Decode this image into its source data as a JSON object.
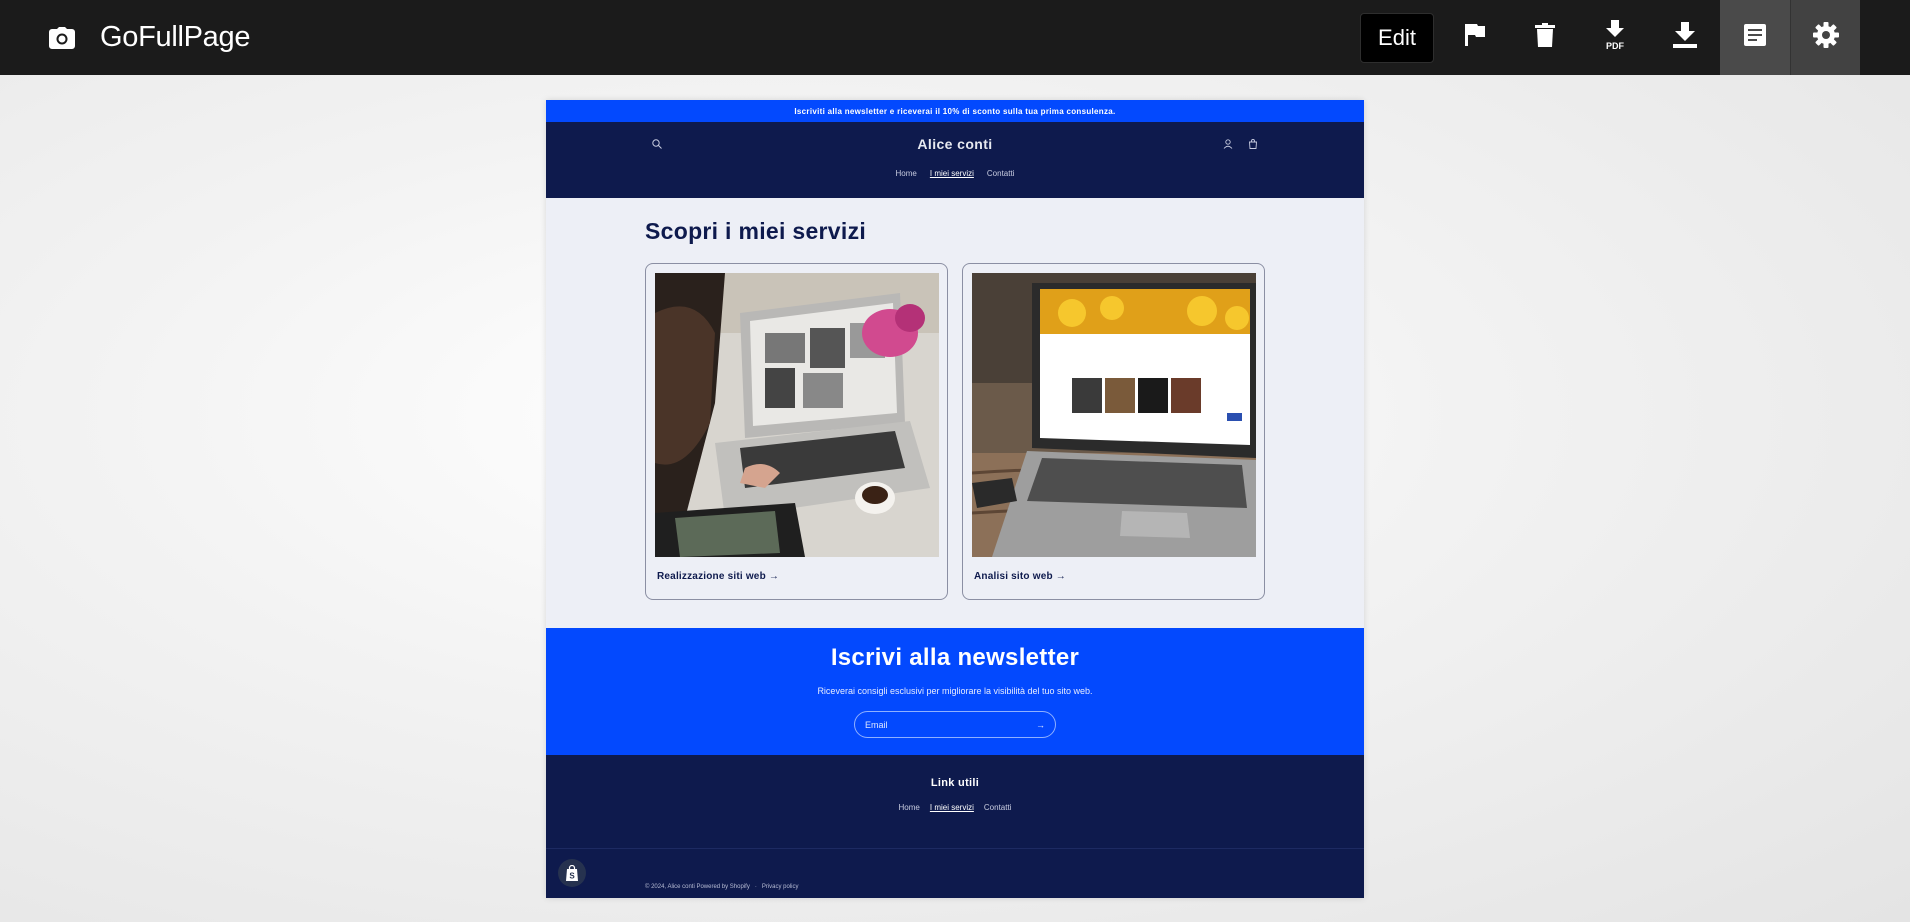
{
  "toolbar": {
    "brand_title": "GoFullPage",
    "edit_label": "Edit",
    "tools": [
      {
        "icon": "flag-icon"
      },
      {
        "icon": "trash-icon"
      },
      {
        "icon": "pdf-download-icon",
        "text": "PDF"
      },
      {
        "icon": "download-icon"
      },
      {
        "icon": "document-icon"
      },
      {
        "icon": "gear-icon"
      }
    ]
  },
  "site": {
    "announcement": "Iscriviti alla newsletter e riceverai il 10% di sconto sulla tua prima consulenza.",
    "logo": "Alice conti",
    "nav": [
      "Home",
      "I miei servizi",
      "Contatti"
    ],
    "current_nav": "I miei servizi",
    "heading": "Scopri i miei servizi",
    "cards": [
      {
        "label": "Realizzazione siti web →"
      },
      {
        "label": "Analisi sito web →"
      }
    ],
    "newsletter": {
      "title": "Iscrivi alla newsletter",
      "text": "Riceverai consigli esclusivi per migliorare la visibilità del tuo sito web.",
      "email_placeholder": "Email",
      "arrow": "→"
    },
    "footer": {
      "title": "Link utili",
      "links": [
        "Home",
        "I miei servizi",
        "Contatti"
      ],
      "copyright": "© 2024, Alice conti Powered by Shopify",
      "separator": "·",
      "privacy": "Privacy policy"
    }
  },
  "colors": {
    "toolbar_bg": "#1b1b1b",
    "announce_bg": "#0349fe",
    "header_bg": "#0e1a4d",
    "page_bg": "#edeff6"
  }
}
